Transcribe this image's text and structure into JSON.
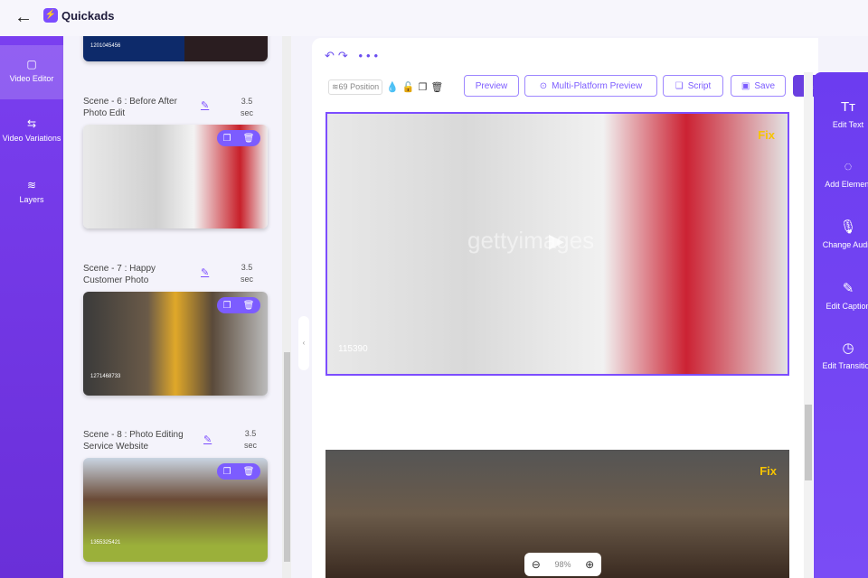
{
  "header": {
    "brand": "Quickads",
    "back": "←"
  },
  "leftnav": [
    {
      "label": "Video Editor",
      "icon": "▢"
    },
    {
      "label": "Video Variations",
      "icon": "⇆"
    },
    {
      "label": "Layers",
      "icon": "≋"
    }
  ],
  "scenes": [
    {
      "id": "1201045456"
    },
    {
      "title": "Scene - 6 : Before After Photo Edit",
      "duration": "3.5",
      "unit": "sec"
    },
    {
      "title": "Scene - 7 : Happy Customer Photo",
      "duration": "3.5",
      "unit": "sec",
      "id": "1271468733"
    },
    {
      "title": "Scene - 8 : Photo Editing Service Website",
      "duration": "3.5",
      "unit": "sec",
      "id": "1355325421"
    }
  ],
  "toolbar": {
    "preview": "Preview",
    "multi": "Multi-Platform Preview",
    "script": "Script",
    "save": "Save",
    "layer_count": "69",
    "position": "Position"
  },
  "canvas": {
    "watermark": "gettyimages",
    "id": "115390",
    "logo": "Fix",
    "zoom": "98%"
  },
  "rightnav": [
    {
      "label": "Edit Text",
      "icon": "Tт"
    },
    {
      "label": "Add Element",
      "icon": "◌"
    },
    {
      "label": "Change Audio",
      "icon": "🎙"
    },
    {
      "label": "Edit Caption",
      "icon": "✎"
    },
    {
      "label": "Edit Transition",
      "icon": "◷"
    }
  ]
}
